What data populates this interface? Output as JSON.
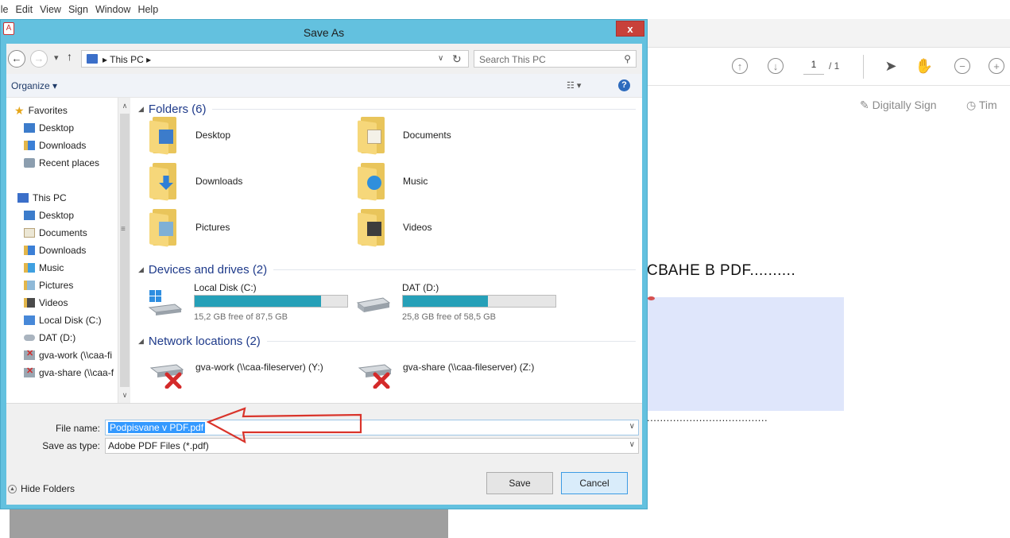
{
  "app": {
    "menu": [
      "ile",
      "Edit",
      "View",
      "Sign",
      "Window",
      "Help"
    ],
    "page_current": "1",
    "page_total": "/ 1",
    "digitally_sign": "Digitally Sign",
    "time_cut": "Tim",
    "doc_heading": "СВАНЕ В PDF..........",
    "doc_dots": ".....................................",
    "colors": {
      "accent": "#63c1df",
      "field": "#dfe6fb"
    }
  },
  "dialog": {
    "title": "Save As",
    "close": "x",
    "address": "This PC",
    "search_placeholder": "Search This PC",
    "organize": "Organize ▾",
    "nav": {
      "favorites": "Favorites",
      "fav_items": [
        "Desktop",
        "Downloads",
        "Recent places"
      ],
      "this_pc": "This PC",
      "pc_items": [
        "Desktop",
        "Documents",
        "Downloads",
        "Music",
        "Pictures",
        "Videos",
        "Local Disk (C:)",
        "DAT (D:)",
        "gva-work (\\\\caa-fi",
        "gva-share (\\\\caa-f"
      ]
    },
    "groups": {
      "folders": "Folders (6)",
      "devices": "Devices and drives (2)",
      "network": "Network locations (2)"
    },
    "folders": [
      "Desktop",
      "Documents",
      "Downloads",
      "Music",
      "Pictures",
      "Videos"
    ],
    "drives": [
      {
        "name": "Local Disk (C:)",
        "free": "15,2 GB free of 87,5 GB",
        "used_fraction": 0.826
      },
      {
        "name": "DAT (D:)",
        "free": "25,8 GB free of 58,5 GB",
        "used_fraction": 0.559
      }
    ],
    "network": [
      "gva-work (\\\\caa-fileserver) (Y:)",
      "gva-share (\\\\caa-fileserver) (Z:)"
    ],
    "file_name_label": "File name:",
    "file_name_value": "Podpisvane v PDF.pdf",
    "save_type_label": "Save as type:",
    "save_type_value": "Adobe PDF Files (*.pdf)",
    "hide_folders": "Hide Folders",
    "save_btn": "Save",
    "cancel_btn": "Cancel"
  }
}
